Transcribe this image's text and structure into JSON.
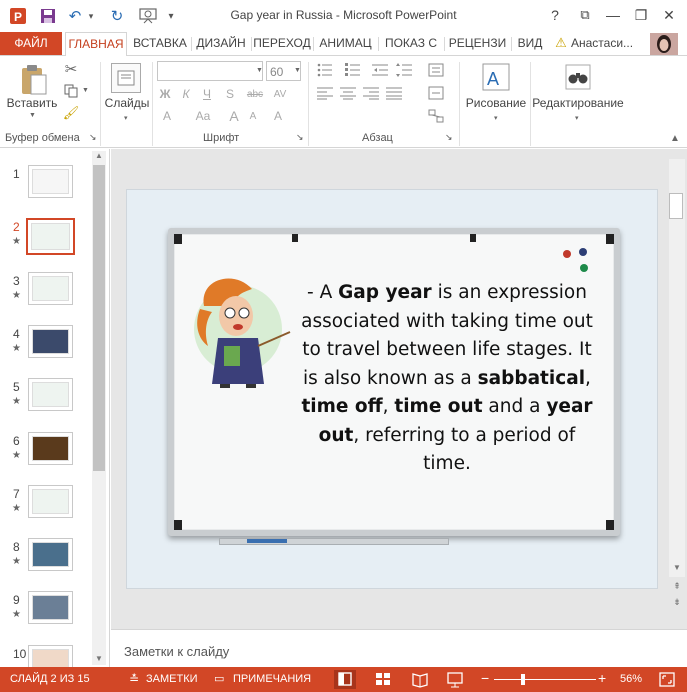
{
  "window": {
    "title": "Gap year in Russia - Microsoft PowerPoint",
    "help": "?",
    "ribbon_display": "⧉",
    "minimize": "—",
    "restore": "❐",
    "close": "✕"
  },
  "quick_access": {
    "save": "💾",
    "undo": "↶",
    "undo_dd": "▾",
    "redo": "↻",
    "from_start": "▶",
    "customize": "▾"
  },
  "tabs": {
    "file": "ФАЙЛ",
    "home": "ГЛАВНАЯ",
    "insert": "ВСТАВКА",
    "design": "ДИЗАЙН",
    "transitions": "ПЕРЕХОД",
    "animations": "АНИМАЦ",
    "slideshow": "ПОКАЗ С",
    "review": "РЕЦЕНЗИ",
    "view": "ВИД",
    "user": "Анастаси..."
  },
  "ribbon": {
    "clipboard": {
      "paste": "Вставить",
      "label": "Буфер обмена",
      "launcher": "↘"
    },
    "slides": {
      "label": "Слайды",
      "dd": "▾"
    },
    "font": {
      "font_name": "",
      "font_size": "60",
      "label": "Шрифт",
      "bold": "Ж",
      "italic": "К",
      "underline": "Ч",
      "shadow": "S",
      "strike": "abc",
      "spacing": "AV",
      "case": "Aa",
      "clear": "A",
      "grow": "A",
      "shrink": "A",
      "color": "A",
      "launcher": "↘"
    },
    "paragraph": {
      "label": "Абзац",
      "launcher": "↘"
    },
    "drawing": {
      "label": "Рисование",
      "dd": "▾"
    },
    "editing": {
      "label": "Редактирование",
      "dd": "▾"
    }
  },
  "slides_panel": {
    "items": [
      {
        "num": "1",
        "star": ""
      },
      {
        "num": "2",
        "star": "★"
      },
      {
        "num": "3",
        "star": "★"
      },
      {
        "num": "4",
        "star": "★"
      },
      {
        "num": "5",
        "star": "★"
      },
      {
        "num": "6",
        "star": "★"
      },
      {
        "num": "7",
        "star": "★"
      },
      {
        "num": "8",
        "star": "★"
      },
      {
        "num": "9",
        "star": "★"
      },
      {
        "num": "10",
        "star": ""
      }
    ],
    "selected": 2
  },
  "slide": {
    "text_prefix": "- A ",
    "term1": "Gap year",
    "text_mid1": " is an expression associated with taking time out to travel between life stages. It is also known as a ",
    "term2": "sabbatical",
    "sep1": ", ",
    "term3": "time off",
    "sep2": ", ",
    "term4": "time out",
    "text_mid2": " and a ",
    "term5": "year out",
    "text_end": ", referring to a period of time."
  },
  "notes": {
    "placeholder": "Заметки к слайду"
  },
  "status": {
    "slide_counter": "СЛАЙД 2 ИЗ 15",
    "notes_btn": "ЗАМЕТКИ",
    "comments_btn": "ПРИМЕЧАНИЯ",
    "zoom_minus": "−",
    "zoom_plus": "+",
    "zoom_level": "56%",
    "zoom_fraction": 0.56
  },
  "colors": {
    "accent": "#d24726",
    "ribbon_text": "#444444",
    "selected_border": "#d24726"
  }
}
